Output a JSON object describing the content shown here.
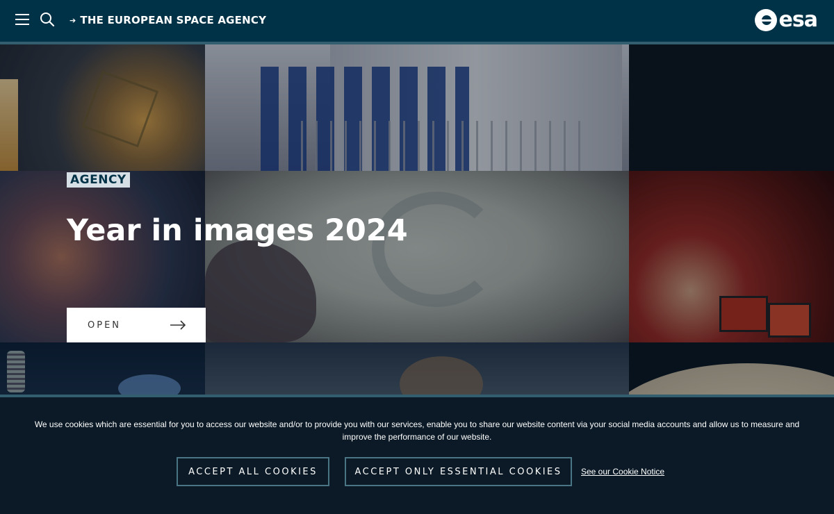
{
  "header": {
    "brand_link": "THE EUROPEAN SPACE AGENCY",
    "logo_text": "esa",
    "bg_color": "#003247"
  },
  "hero": {
    "tag": "AGENCY",
    "title": "Year in images 2024",
    "open_label": "OPEN"
  },
  "cookie_banner": {
    "text": "We use cookies which are essential for you to access our website and/or to provide you with our services, enable you to share our website content via your social media accounts and allow us to measure and improve the performance of our website.",
    "accept_all": "ACCEPT ALL COOKIES",
    "accept_essential": "ACCEPT ONLY ESSENTIAL COOKIES",
    "notice_link": "See our Cookie Notice"
  },
  "icons": [
    "menu-icon",
    "search-icon",
    "arrow-right-icon",
    "esa-logo"
  ]
}
